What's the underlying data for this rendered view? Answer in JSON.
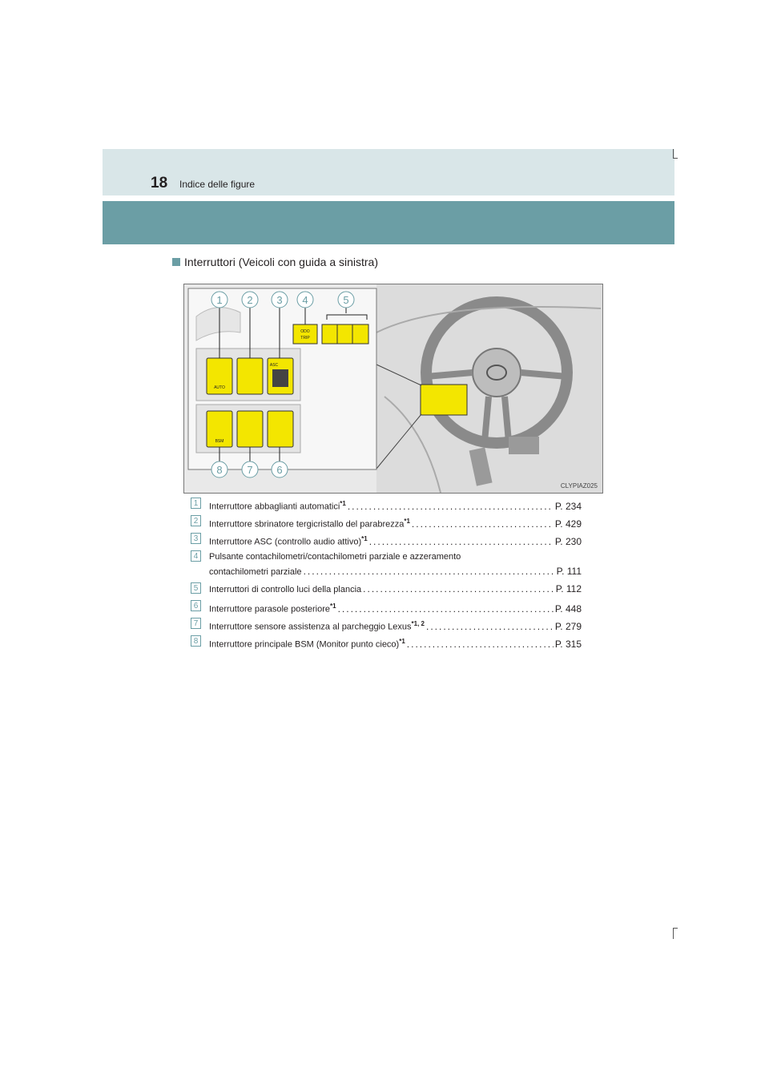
{
  "header": {
    "page_number": "18",
    "section_title": "Indice delle figure"
  },
  "subheading": "Interruttori (Veicoli con guida a sinistra)",
  "figure": {
    "callouts_top": [
      "1",
      "2",
      "3",
      "4",
      "5"
    ],
    "callouts_bottom": [
      "8",
      "7",
      "6"
    ],
    "code": "CLYPIAZ025",
    "switch_labels": {
      "auto": "AUTO",
      "asc": "ASC",
      "odo": "ODO",
      "trip": "TRIP",
      "bsm": "BSM"
    }
  },
  "items": [
    {
      "num": "1",
      "label": "Interruttore abbaglianti automatici",
      "sup": "*1",
      "page": "P. 234"
    },
    {
      "num": "2",
      "label": "Interruttore sbrinatore tergicristallo del parabrezza",
      "sup": "*1",
      "page": "P. 429"
    },
    {
      "num": "3",
      "label": "Interruttore ASC (controllo audio attivo)",
      "sup": "*1",
      "page": "P. 230"
    },
    {
      "num": "4",
      "label": "Pulsante contachilometri/contachilometri parziale e azzeramento",
      "label2": "contachilometri parziale",
      "page": "P. 111"
    },
    {
      "num": "5",
      "label": "Interruttori di controllo luci della plancia",
      "page": "P. 112"
    },
    {
      "num": "6",
      "label": "Interruttore parasole posteriore",
      "sup": "*1",
      "page": "P. 448"
    },
    {
      "num": "7",
      "label": "Interruttore sensore assistenza al parcheggio Lexus",
      "sup": "*1, 2",
      "page": "P. 279"
    },
    {
      "num": "8",
      "label": "Interruttore principale BSM (Monitor punto cieco)",
      "sup": "*1",
      "page": "P. 315"
    }
  ]
}
